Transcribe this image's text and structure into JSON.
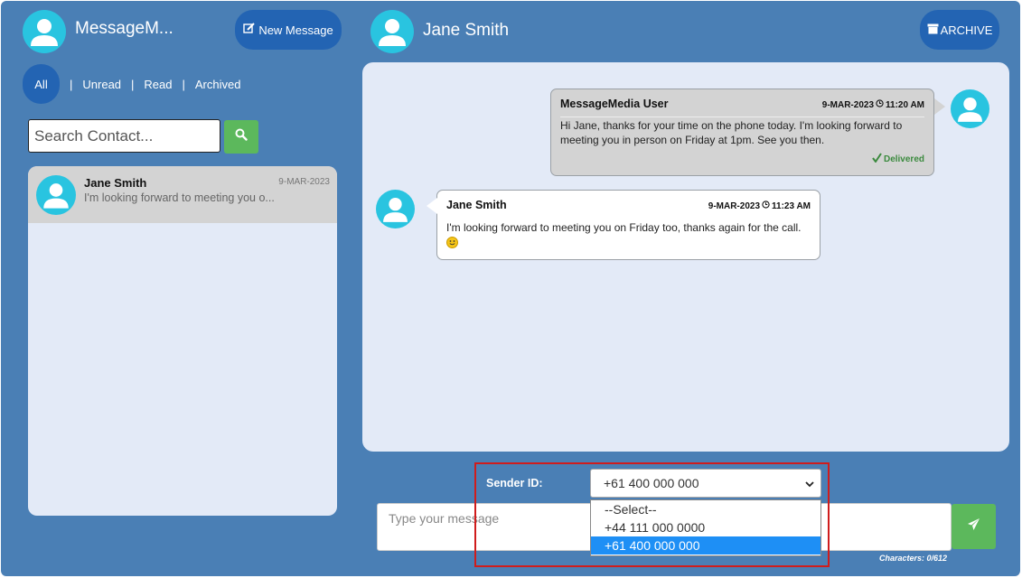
{
  "left": {
    "app_name": "MessageM...",
    "new_message_label": "New Message",
    "filters": [
      "All",
      "Unread",
      "Read",
      "Archived"
    ],
    "search_placeholder": "Search Contact...",
    "contacts": [
      {
        "name": "Jane Smith",
        "date": "9-MAR-2023",
        "preview": "I'm looking forward to meeting you o..."
      }
    ]
  },
  "right": {
    "contact_name": "Jane Smith",
    "archive_label": "ARCHIVE",
    "messages": [
      {
        "direction": "out",
        "sender": "MessageMedia User",
        "date": "9-MAR-2023",
        "time": "11:20 AM",
        "text": "Hi Jane, thanks for your time on the phone today. I'm looking forward to meeting you in person on Friday at 1pm. See you then.",
        "status": "Delivered"
      },
      {
        "direction": "in",
        "sender": "Jane Smith",
        "date": "9-MAR-2023",
        "time": "11:23 AM",
        "text": "I'm looking forward to meeting you on Friday too, thanks again for the call."
      }
    ]
  },
  "composer": {
    "sender_label": "Sender ID:",
    "sender_selected": "+61 400 000 000",
    "sender_options": [
      "--Select--",
      "+44 111 000 0000",
      "+61 400 000 000"
    ],
    "message_placeholder": "Type your message",
    "chars_label": "Characters: 0/612"
  },
  "colors": {
    "app_bg": "#4a7fb5",
    "button_blue": "#2364b3",
    "green": "#5cb85c",
    "avatar": "#29c4e0",
    "panel": "#e3eaf7",
    "highlight": "#d01c1c",
    "option_selected": "#1e8ff5"
  },
  "icons": {
    "avatar": "user-avatar-icon",
    "new_message": "edit-icon",
    "search": "search-icon",
    "archive": "archive-box-icon",
    "clock": "clock-icon",
    "check": "checkmark-icon",
    "send": "send-icon",
    "dropdown": "chevron-down-icon",
    "emoji": "smiley-emoji-icon"
  }
}
